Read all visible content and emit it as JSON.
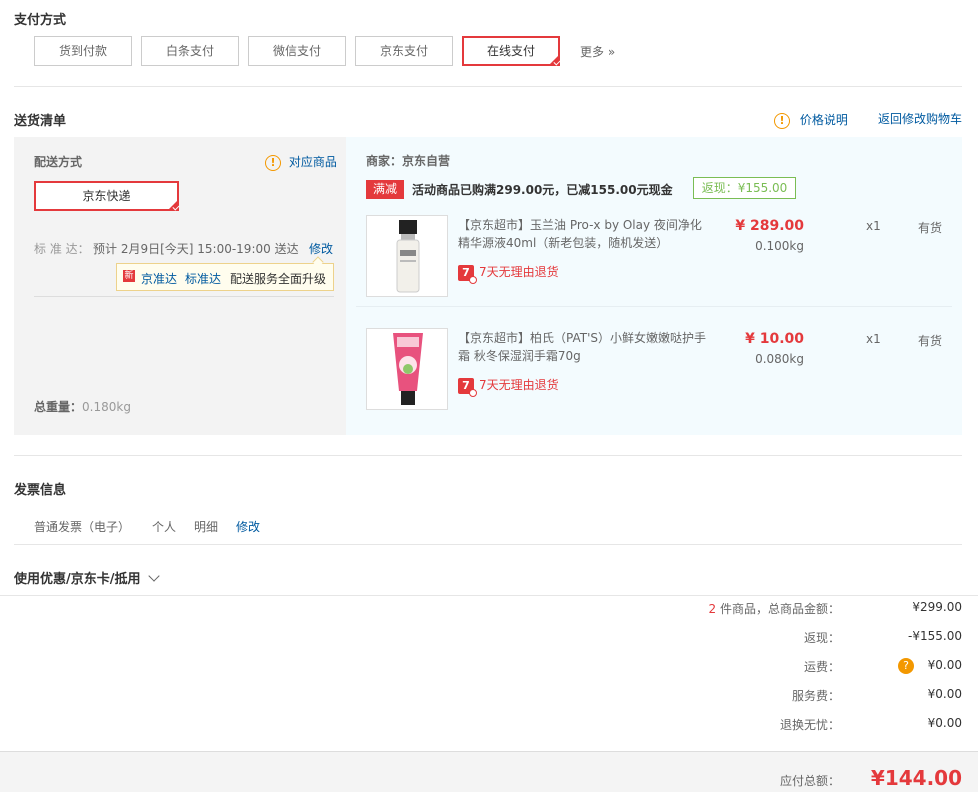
{
  "payment": {
    "title": "支付方式",
    "options": [
      "货到付款",
      "白条支付",
      "微信支付",
      "京东支付",
      "在线支付"
    ],
    "more": "更多 »"
  },
  "delivery": {
    "title": "送货清单",
    "price_note": "价格说明",
    "back_to_cart": "返回修改购物车",
    "method_title": "配送方式",
    "matching_items": "对应商品",
    "method_selected": "京东快递",
    "standard_label": "标 准 达：",
    "eta": "预计 2月9日[今天] 15:00-19:00 送达",
    "modify": "修改",
    "tip_new": "新",
    "tip_brand": "京准达",
    "tip_std": "标准达",
    "tip_text": "配送服务全面升级",
    "total_weight_label": "总重量：",
    "total_weight": "0.180kg"
  },
  "merchant": {
    "label": "商家：京东自营",
    "promo_tag": "满减",
    "promo_text": "活动商品已购满299.00元，已减155.00元现金",
    "cashback": "返现：¥155.00"
  },
  "items": [
    {
      "name": "【京东超市】玉兰油 Pro-x by Olay 夜间净化精华源液40ml（新老包装，随机发送）",
      "price": "¥ 289.00",
      "weight": "0.100kg",
      "qty": "x1",
      "stock": "有货",
      "returns": "7天无理由退货",
      "badge": "7"
    },
    {
      "name": "【京东超市】柏氏（PAT'S）小鲜女嫩嫩哒护手霜 秋冬保湿润手霜70g",
      "price": "¥ 10.00",
      "weight": "0.080kg",
      "qty": "x1",
      "stock": "有货",
      "returns": "7天无理由退货",
      "badge": "7"
    }
  ],
  "invoice": {
    "title": "发票信息",
    "type": "普通发票（电子）",
    "personal": "个人",
    "detail": "明细",
    "modify": "修改"
  },
  "coupon": {
    "title": "使用优惠/京东卡/抵用"
  },
  "summary": {
    "count": "2",
    "count_label": "件商品，总商品金额：",
    "goods_total": "¥299.00",
    "cashback_label": "返现：",
    "cashback": "-¥155.00",
    "shipping_label": "运费：",
    "shipping": "¥0.00",
    "service_label": "服务费：",
    "service": "¥0.00",
    "return_label": "退换无忧：",
    "return": "¥0.00",
    "payable_label": "应付总额：",
    "payable": "¥144.00"
  }
}
